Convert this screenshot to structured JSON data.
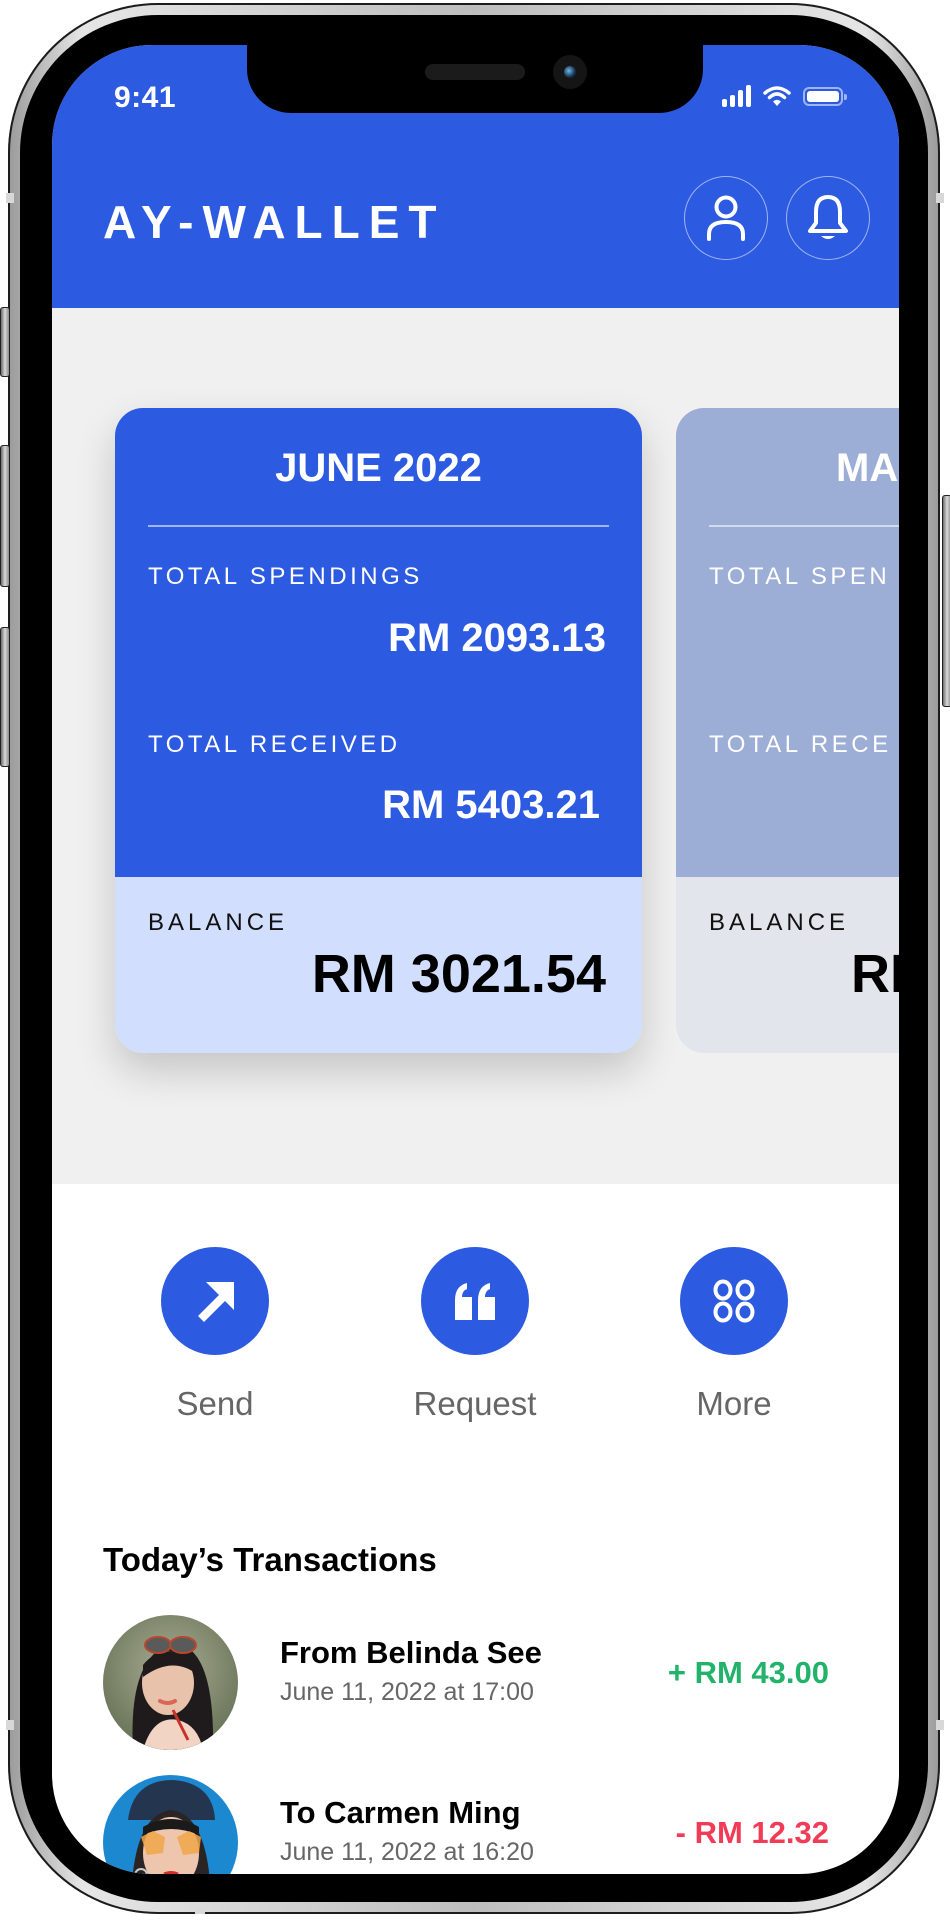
{
  "status_bar": {
    "time": "9:41"
  },
  "header": {
    "brand": "AY-WALLET",
    "profile_icon": "person-icon",
    "notification_icon": "bell-icon"
  },
  "colors": {
    "brand_blue": "#2c5ae0",
    "balance_bg": "#d2defd",
    "income_green": "#22b36a",
    "expense_red": "#f23c57",
    "inactive_card": "#9cadd6"
  },
  "cards": [
    {
      "month": "JUNE 2022",
      "spendings_label": "TOTAL SPENDINGS",
      "spendings_value": "RM 2093.13",
      "received_label": "TOTAL RECEIVED",
      "received_value": "RM 5403.21",
      "balance_label": "BALANCE",
      "balance_value": "RM 3021.54"
    },
    {
      "month": "MA",
      "spendings_label": "TOTAL SPEN",
      "received_label": "TOTAL RECE",
      "balance_label": "BALANCE",
      "balance_value": "RI"
    }
  ],
  "actions": [
    {
      "label": "Send",
      "icon": "arrow-up-right-icon"
    },
    {
      "label": "Request",
      "icon": "quote-icon"
    },
    {
      "label": "More",
      "icon": "grid-circles-icon"
    }
  ],
  "transactions": {
    "title": "Today’s Transactions",
    "items": [
      {
        "name": "From Belinda See",
        "date": "June 11, 2022 at 17:00",
        "amount": "+ RM 43.00",
        "type": "income"
      },
      {
        "name": "To Carmen Ming",
        "date": "June 11, 2022 at 16:20",
        "amount": "- RM 12.32",
        "type": "expense"
      }
    ]
  }
}
